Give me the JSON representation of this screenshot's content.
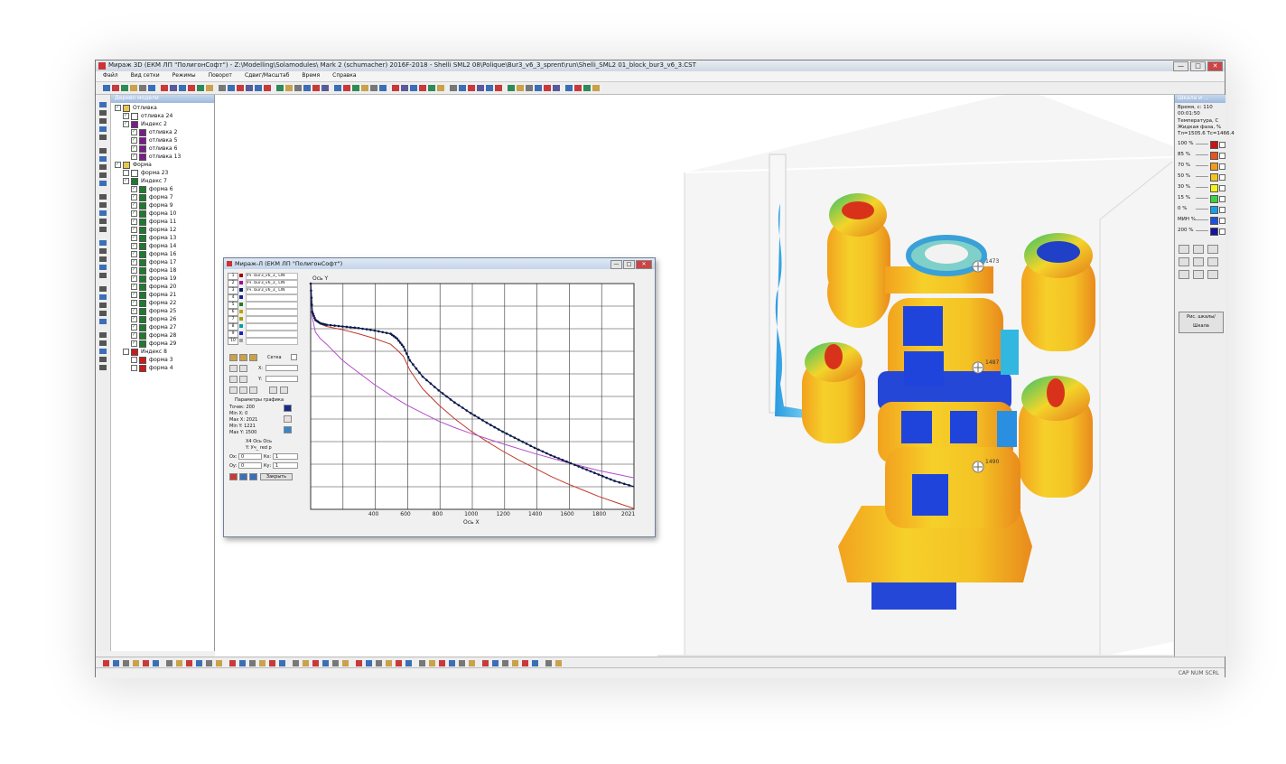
{
  "window": {
    "title": "Мираж 3D (ЕКМ ЛП \"ПолигонСофт\") - Z:\\Modelling\\Solamodules\\ Mark 2 (schumacher) 2016F-2018 - Shelli SML2 08\\Polique\\Bur3_v6_3_sprent\\run\\Shelli_SML2 01_block_bur3_v6_3.CST",
    "controls": {
      "minimize": "—",
      "maximize": "□",
      "close": "✕"
    }
  },
  "menu": [
    "Файл",
    "Вид сетки",
    "Режимы",
    "Поворот",
    "Сдвиг/Масштаб",
    "Время",
    "Справка"
  ],
  "tree_panel": {
    "header": "Дерево модели",
    "items": [
      {
        "label": "Отливка",
        "level": 0,
        "color": "#e8c84a",
        "checked": true
      },
      {
        "label": "отливка 24",
        "level": 1,
        "color": "#ffffff",
        "checked": true
      },
      {
        "label": "Индекс 2",
        "level": 1,
        "color": "#7a1b8a",
        "checked": true
      },
      {
        "label": "отливка 2",
        "level": 2,
        "color": "#7a1b8a",
        "checked": true
      },
      {
        "label": "отливка 5",
        "level": 2,
        "color": "#7a1b8a",
        "checked": true
      },
      {
        "label": "отливка 6",
        "level": 2,
        "color": "#7a1b8a",
        "checked": true
      },
      {
        "label": "отливка 13",
        "level": 2,
        "color": "#7a1b8a",
        "checked": true
      },
      {
        "label": "Форма",
        "level": 0,
        "color": "#e8c84a",
        "checked": true
      },
      {
        "label": "форма 23",
        "level": 1,
        "color": "#ffffff",
        "checked": false
      },
      {
        "label": "Индекс 7",
        "level": 1,
        "color": "#1e7b2e",
        "checked": true
      },
      {
        "label": "форма 6",
        "level": 2,
        "color": "#1e7b2e",
        "checked": true
      },
      {
        "label": "форма 7",
        "level": 2,
        "color": "#1e7b2e",
        "checked": true
      },
      {
        "label": "форма 9",
        "level": 2,
        "color": "#1e7b2e",
        "checked": true
      },
      {
        "label": "форма 10",
        "level": 2,
        "color": "#1e7b2e",
        "checked": true
      },
      {
        "label": "форма 11",
        "level": 2,
        "color": "#1e7b2e",
        "checked": true
      },
      {
        "label": "форма 12",
        "level": 2,
        "color": "#1e7b2e",
        "checked": true
      },
      {
        "label": "форма 13",
        "level": 2,
        "color": "#1e7b2e",
        "checked": true
      },
      {
        "label": "форма 14",
        "level": 2,
        "color": "#1e7b2e",
        "checked": true
      },
      {
        "label": "форма 16",
        "level": 2,
        "color": "#1e7b2e",
        "checked": true
      },
      {
        "label": "форма 17",
        "level": 2,
        "color": "#1e7b2e",
        "checked": true
      },
      {
        "label": "форма 18",
        "level": 2,
        "color": "#1e7b2e",
        "checked": true
      },
      {
        "label": "форма 19",
        "level": 2,
        "color": "#1e7b2e",
        "checked": true
      },
      {
        "label": "форма 20",
        "level": 2,
        "color": "#1e7b2e",
        "checked": true
      },
      {
        "label": "форма 21",
        "level": 2,
        "color": "#1e7b2e",
        "checked": true
      },
      {
        "label": "форма 22",
        "level": 2,
        "color": "#1e7b2e",
        "checked": true
      },
      {
        "label": "форма 25",
        "level": 2,
        "color": "#1e7b2e",
        "checked": true
      },
      {
        "label": "форма 26",
        "level": 2,
        "color": "#1e7b2e",
        "checked": true
      },
      {
        "label": "форма 27",
        "level": 2,
        "color": "#1e7b2e",
        "checked": true
      },
      {
        "label": "форма 28",
        "level": 2,
        "color": "#1e7b2e",
        "checked": true
      },
      {
        "label": "форма 29",
        "level": 2,
        "color": "#1e7b2e",
        "checked": true
      },
      {
        "label": "Индекс 8",
        "level": 1,
        "color": "#cc1a1a",
        "checked": false
      },
      {
        "label": "форма 3",
        "level": 2,
        "color": "#cc1a1a",
        "checked": false
      },
      {
        "label": "форма 4",
        "level": 2,
        "color": "#cc1a1a",
        "checked": false
      }
    ]
  },
  "right_panel": {
    "header": "Шкала и ...",
    "time_label": "Время, с: 110",
    "time_value": "00:01:50",
    "field_label": "Температура, С",
    "field_sub": "Жидкая фаза, %",
    "range": "Тл=1505.6 Тс=1466.4",
    "legend": [
      {
        "label": "100 %",
        "color": "#c81414"
      },
      {
        "label": "85 %",
        "color": "#e8541a"
      },
      {
        "label": "70 %",
        "color": "#f39a1c"
      },
      {
        "label": "50 %",
        "color": "#f3c51c"
      },
      {
        "label": "30 %",
        "color": "#f5f514"
      },
      {
        "label": "15 %",
        "color": "#3cd23c"
      },
      {
        "label": "0 %",
        "color": "#14a0e6"
      },
      {
        "label": "МИН %",
        "color": "#1e50dc"
      },
      {
        "label": "200 %",
        "color": "#1414a0"
      }
    ],
    "bottom_button": "Рис. шкалы/Шкала"
  },
  "annotations": [
    "1473",
    "1487",
    "1490"
  ],
  "graph_window": {
    "title": "Мираж-Л (ЕКМ ЛП \"ПолигонСофт\")",
    "series_rows": [
      {
        "num": "1",
        "color": "#a00000",
        "text": "Уч. bur3_v6_3_ LIN"
      },
      {
        "num": "2",
        "color": "#a000a0",
        "text": "Уч. bur3_v6_3_ LIN"
      },
      {
        "num": "3",
        "color": "#0a1a5c",
        "text": "Уч. bur3_v6_3_ LIN"
      },
      {
        "num": "4",
        "color": "#1a1aa0",
        "text": ""
      },
      {
        "num": "5",
        "color": "#1e7b2e",
        "text": ""
      },
      {
        "num": "6",
        "color": "#c8a000",
        "text": ""
      },
      {
        "num": "7",
        "color": "#a0a000",
        "text": ""
      },
      {
        "num": "8",
        "color": "#00a0a0",
        "text": ""
      },
      {
        "num": "9",
        "color": "#2020c0",
        "text": ""
      },
      {
        "num": "10",
        "color": "#a0a0a0",
        "text": ""
      }
    ],
    "sync_label": "Сетка",
    "x_field": "X:",
    "y_field": "Y:",
    "params_title": "Параметры графика",
    "params": [
      "Точек: 200",
      "Min X: 0",
      "Max X: 2021",
      "Min Y: 1221",
      "Max Y: 1500"
    ],
    "hint_line1": "Х4 Ось Ось",
    "hint_line2": "Y: Уч_ red p",
    "ox_label": "Ох:",
    "ox_value": "0",
    "kx_label": "Кх:",
    "kx_value": "1",
    "oy_label": "Оу:",
    "oy_value": "0",
    "ky_label": "Ку:",
    "ky_value": "1",
    "close_button": "Закрыть"
  },
  "chart_data": {
    "type": "line",
    "ylabel": "Ось Y",
    "xlabel": "Ось X",
    "xlim": [
      0,
      2021
    ],
    "ylim": [
      1221,
      1500
    ],
    "x_ticks": [
      400,
      600,
      800,
      1000,
      1200,
      1400,
      1600,
      1800,
      2021
    ],
    "x_tick_labels": [
      "400",
      "600",
      "800",
      "1000",
      "1200",
      "1400",
      "1600",
      "1800",
      "2021"
    ],
    "series": [
      {
        "color": "#c0392b",
        "marker": false,
        "x": [
          0,
          10,
          30,
          60,
          100,
          200,
          300,
          400,
          500,
          540,
          580,
          620,
          700,
          800,
          900,
          1000,
          1100,
          1200,
          1300,
          1400,
          1500,
          1600,
          1700,
          1800,
          1900,
          2021
        ],
        "y": [
          1500,
          1465,
          1455,
          1450,
          1447,
          1443,
          1438,
          1432,
          1425,
          1418,
          1410,
          1393,
          1370,
          1350,
          1333,
          1318,
          1305,
          1293,
          1282,
          1272,
          1262,
          1253,
          1245,
          1237,
          1230,
          1222
        ]
      },
      {
        "color": "#b44cc8",
        "marker": false,
        "x": [
          0,
          10,
          30,
          60,
          100,
          150,
          200,
          300,
          400,
          500,
          600,
          700,
          800,
          900,
          1000,
          1200,
          1400,
          1600,
          1800,
          2021
        ],
        "y": [
          1500,
          1458,
          1440,
          1432,
          1425,
          1415,
          1405,
          1390,
          1375,
          1362,
          1350,
          1340,
          1330,
          1322,
          1315,
          1302,
          1290,
          1279,
          1269,
          1260
        ]
      },
      {
        "color": "#0b1a4a",
        "marker": true,
        "x": [
          0,
          10,
          30,
          60,
          100,
          200,
          300,
          400,
          500,
          540,
          580,
          620,
          700,
          800,
          900,
          1000,
          1100,
          1200,
          1300,
          1400,
          1500,
          1600,
          1700,
          1800,
          1900,
          2021
        ],
        "y": [
          1500,
          1465,
          1455,
          1451,
          1449,
          1447,
          1445,
          1442,
          1438,
          1432,
          1422,
          1405,
          1385,
          1368,
          1353,
          1340,
          1328,
          1317,
          1307,
          1297,
          1288,
          1280,
          1272,
          1264,
          1256,
          1249
        ]
      }
    ]
  }
}
